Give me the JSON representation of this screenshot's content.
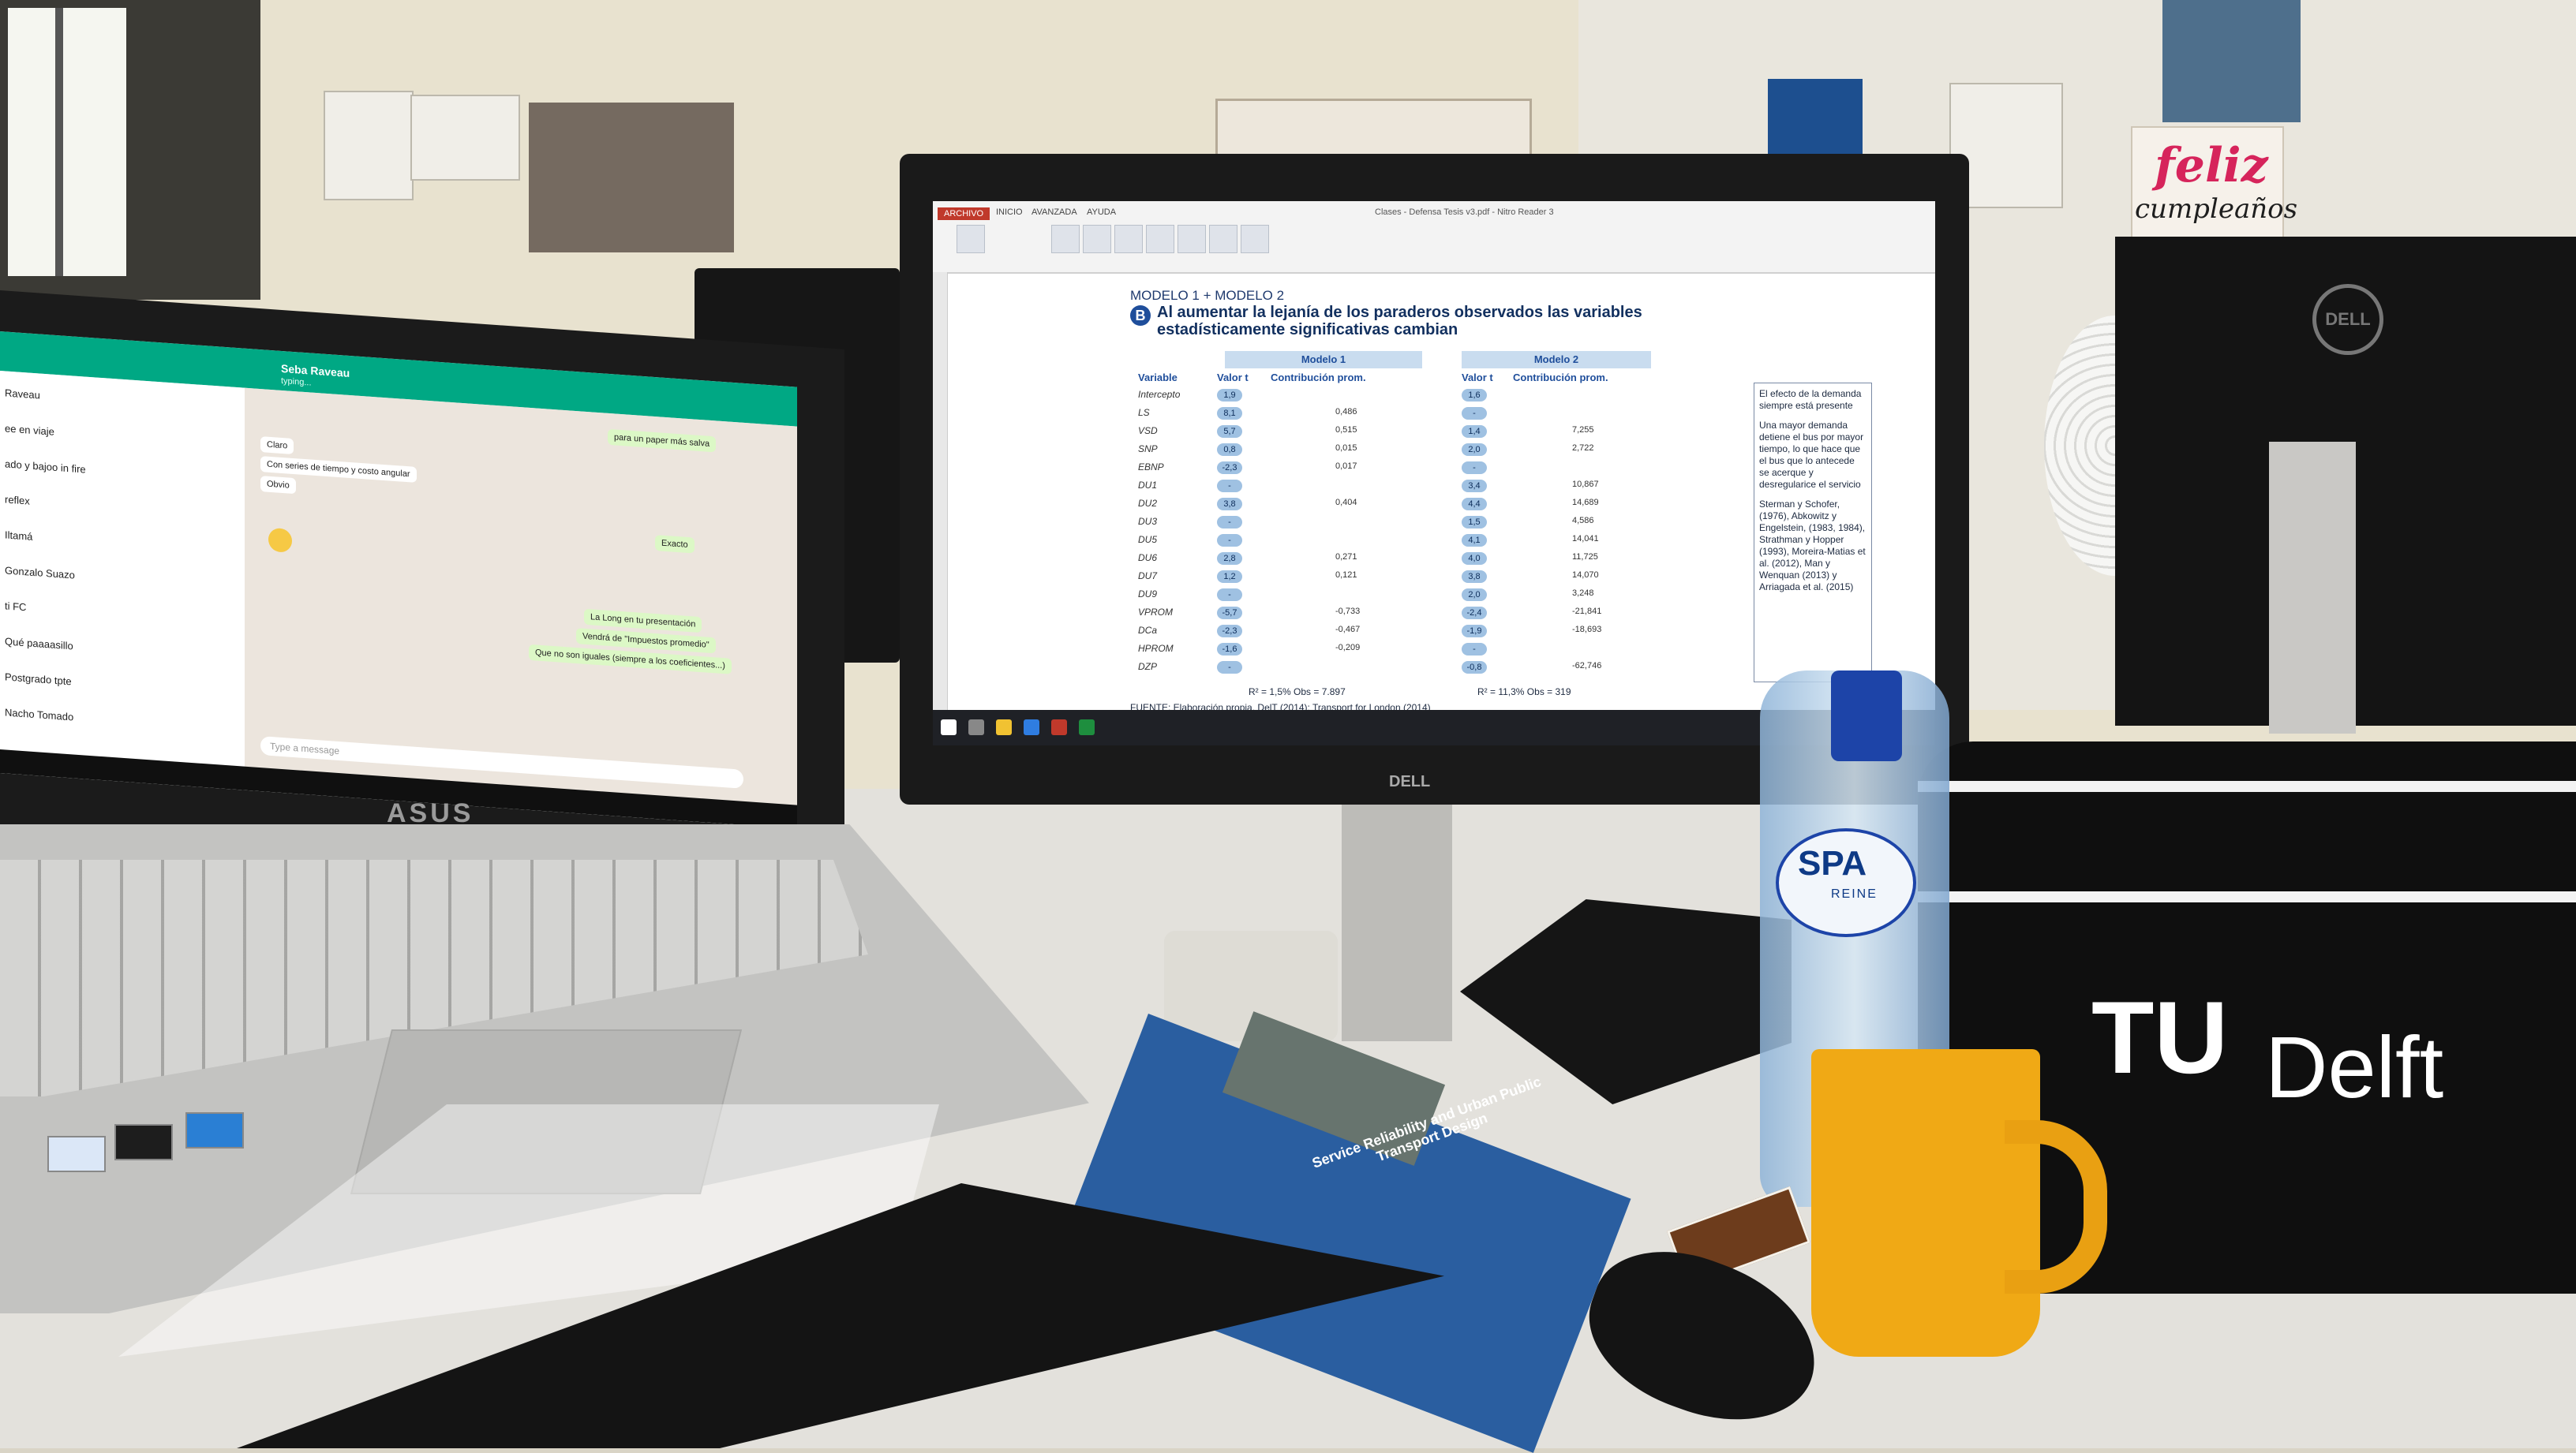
{
  "laptop": {
    "brand": "ASUS",
    "whatsapp": {
      "contact_name": "Seba Raveau",
      "contact_status": "typing...",
      "chats": [
        "Raveau",
        "ee en viaje",
        "ado y bajoo in fire",
        "reflex",
        "Iltamá",
        "Gonzalo Suazo",
        "ti FC",
        "Qué paaaasillo",
        "Postgrado tpte",
        "Nacho Tomado"
      ],
      "messages_in": [
        "Claro",
        "Con series de tiempo y costo angular",
        "Obvio"
      ],
      "messages_out": [
        "para un paper más salva",
        "Exacto",
        "La Long en tu presentación",
        "Vendrá de \"Impuestos promedio\"",
        "Que no son iguales (siempre a los coeficientes...)"
      ],
      "input_placeholder": "Type a message"
    }
  },
  "monitor": {
    "brand": "DELL",
    "app_title": "Clases - Defensa Tesis v3.pdf - Nitro Reader 3",
    "ribbon_tabs": [
      "ARCHIVO",
      "INICIO",
      "AVANZADA",
      "AYUDA"
    ],
    "slide": {
      "subtitle": "MODELO 1 + MODELO 2",
      "badge": "B",
      "title": "Al aumentar la lejanía de los paraderos observados las variables estadísticamente significativas cambian",
      "model1": "Modelo 1",
      "model2": "Modelo 2",
      "col_variable": "Variable",
      "col_valor": "Valor t",
      "col_contrib": "Contribución prom.",
      "rows": [
        {
          "var": "Intercepto",
          "t1": "1,9",
          "c1": "",
          "t2": "1,6",
          "c2": ""
        },
        {
          "var": "LS",
          "t1": "8,1",
          "c1": "0,486",
          "t2": "-",
          "c2": ""
        },
        {
          "var": "VSD",
          "t1": "5,7",
          "c1": "0,515",
          "t2": "1,4",
          "c2": "7,255"
        },
        {
          "var": "SNP",
          "t1": "0,8",
          "c1": "0,015",
          "t2": "2,0",
          "c2": "2,722"
        },
        {
          "var": "EBNP",
          "t1": "-2,3",
          "c1": "0,017",
          "t2": "-",
          "c2": ""
        },
        {
          "var": "DU1",
          "t1": "-",
          "c1": "",
          "t2": "3,4",
          "c2": "10,867"
        },
        {
          "var": "DU2",
          "t1": "3,8",
          "c1": "0,404",
          "t2": "4,4",
          "c2": "14,689"
        },
        {
          "var": "DU3",
          "t1": "-",
          "c1": "",
          "t2": "1,5",
          "c2": "4,586"
        },
        {
          "var": "DU5",
          "t1": "-",
          "c1": "",
          "t2": "4,1",
          "c2": "14,041"
        },
        {
          "var": "DU6",
          "t1": "2,8",
          "c1": "0,271",
          "t2": "4,0",
          "c2": "11,725"
        },
        {
          "var": "DU7",
          "t1": "1,2",
          "c1": "0,121",
          "t2": "3,8",
          "c2": "14,070"
        },
        {
          "var": "DU9",
          "t1": "-",
          "c1": "",
          "t2": "2,0",
          "c2": "3,248"
        },
        {
          "var": "VPROM",
          "t1": "-5,7",
          "c1": "-0,733",
          "t2": "-2,4",
          "c2": "-21,841"
        },
        {
          "var": "DCa",
          "t1": "-2,3",
          "c1": "-0,467",
          "t2": "-1,9",
          "c2": "-18,693"
        },
        {
          "var": "HPROM",
          "t1": "-1,6",
          "c1": "-0,209",
          "t2": "-",
          "c2": ""
        },
        {
          "var": "DZP",
          "t1": "-",
          "c1": "",
          "t2": "-0,8",
          "c2": "-62,746"
        }
      ],
      "stats1": "R² = 1,5%   Obs = 7.897",
      "stats2": "R² = 11,3%   Obs = 319",
      "notes": [
        "El efecto de la demanda siempre está presente",
        "Una mayor demanda detiene el bus por mayor tiempo, lo que hace que el bus que lo antecede se acerque y desregularice el servicio",
        "Sterman y Schofer, (1976), Abkowitz y Engelstein, (1983, 1984), Strathman y Hopper (1993), Moreira-Matias et al. (2012), Man y Wenquan (2013) y Arriagada et al. (2015)"
      ],
      "source": "FUENTE: Elaboración propia, DelT (2014); Transport for London (2014)"
    }
  },
  "objects": {
    "bottle_brand": "SPA",
    "bottle_sub": "REINE",
    "book_title": "Service Reliability and Urban Public Transport Design",
    "bag_brand_1": "TU",
    "bag_brand_2": "Delft",
    "poster_1": "feliz",
    "poster_2": "cumpleaños",
    "right_monitor_brand": "DELL"
  },
  "colors": {
    "whatsapp": "#00a884",
    "slide_blue": "#1f4e9b",
    "ribbon_red": "#c0392b",
    "mug_yellow": "#f0a915"
  }
}
